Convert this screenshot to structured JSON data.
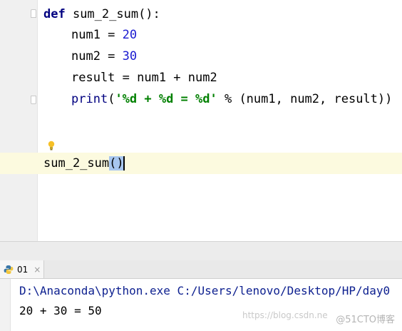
{
  "editor": {
    "lines": {
      "def_kw": "def",
      "def_rest": " sum_2_sum():",
      "num1_name": "num1 = ",
      "num1_value": "20",
      "num2_name": "num2 = ",
      "num2_value": "30",
      "result": "result = num1 + num2",
      "print_fn": "print",
      "print_open": "(",
      "print_fmt": "'%d + %d = %d'",
      "print_rest": " % (num1, num2, result))",
      "call_name": "sum_2_sum",
      "call_parens": "()"
    }
  },
  "run_panel": {
    "tab_label": "01",
    "tab_close": "×"
  },
  "console": {
    "command": "D:\\Anaconda\\python.exe C:/Users/lenovo/Desktop/HP/day0",
    "output": "20 + 30 = 50"
  },
  "watermark": {
    "url_text": "https://blog.csdn.ne",
    "site_text": "@51CTO博客"
  },
  "colors": {
    "keyword": "#000080",
    "number": "#1a1ad0",
    "string": "#008000",
    "current_line": "#fcfadf",
    "console_command": "#0c1f8f"
  },
  "icons": {
    "fold": "fold-marker-icon",
    "bulb": "lightbulb-icon",
    "python": "python-icon"
  }
}
